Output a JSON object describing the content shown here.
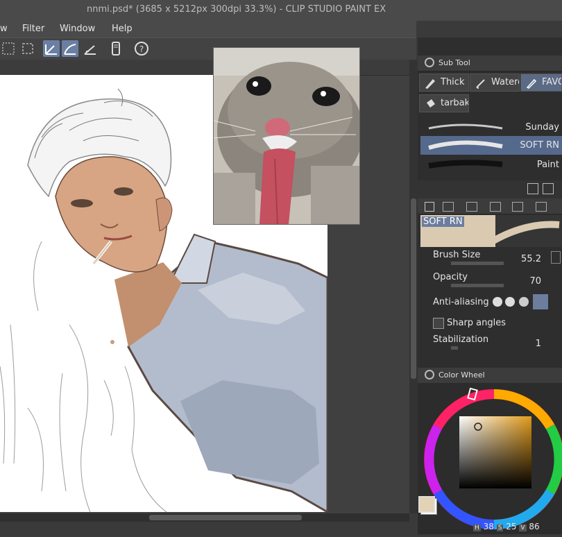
{
  "window": {
    "title": "nnmi.psd* (3685 x 5212px 300dpi 33.3%)  -  CLIP STUDIO PAINT EX"
  },
  "menu": {
    "items": [
      "w",
      "Filter",
      "Window",
      "Help"
    ]
  },
  "sub_tool_panel": {
    "header": "Sub Tool",
    "tabs": [
      {
        "label": "Thick"
      },
      {
        "label": "Waterc"
      },
      {
        "label": "FAVO"
      },
      {
        "label": "tarbak"
      }
    ],
    "brushes": [
      {
        "name": "Sunday",
        "selected": false
      },
      {
        "name": "SOFT RN",
        "selected": true
      },
      {
        "name": "Paint",
        "selected": false
      }
    ]
  },
  "tool_property": {
    "brush_name": "SOFT RN",
    "brush_size_label": "Brush Size",
    "brush_size_value": "55.2",
    "opacity_label": "Opacity",
    "opacity_value": "70",
    "anti_aliasing_label": "Anti-aliasing",
    "sharp_angles_label": "Sharp angles",
    "stabilization_label": "Stabilization",
    "stabilization_value": "1"
  },
  "color_wheel": {
    "header": "Color Wheel",
    "h_label": "H",
    "h_value": "38",
    "s_label": "S",
    "s_value": "25",
    "v_label": "V",
    "v_value": "86",
    "main_color": "#e3d2b4",
    "sub_color": "#ffffff"
  },
  "colors": {
    "accent": "#5b6a85",
    "panel_bg": "#2e2e2e",
    "toolbar_bg": "#434343"
  }
}
